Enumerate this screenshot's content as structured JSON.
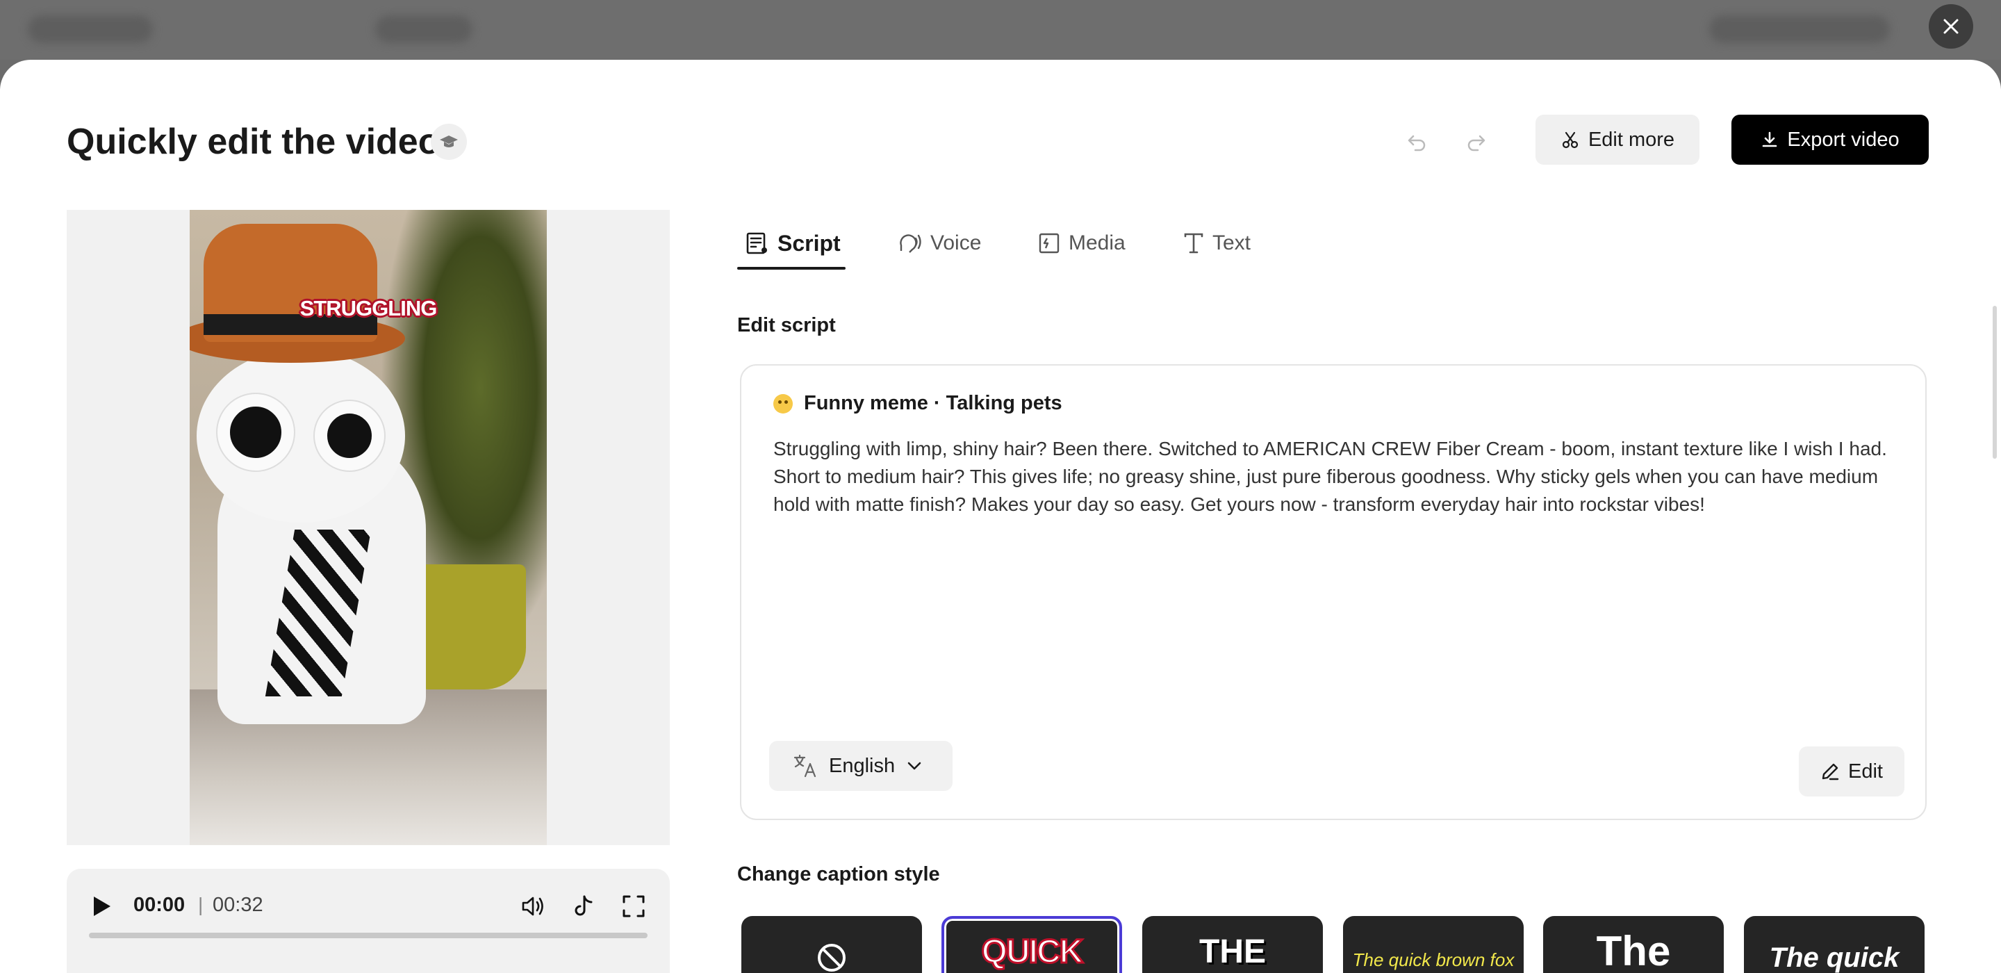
{
  "dialog": {
    "title": "Quickly edit the video",
    "edit_more_label": "Edit more",
    "export_label": "Export video"
  },
  "video": {
    "caption_word": "STRUGGLING",
    "current_time": "00:00",
    "separator": "|",
    "total_time": "00:32",
    "progress_percent": 0
  },
  "tabs": [
    {
      "label": "Script",
      "icon": "script-icon",
      "active": true
    },
    {
      "label": "Voice",
      "icon": "voice-icon",
      "active": false
    },
    {
      "label": "Media",
      "icon": "media-icon",
      "active": false
    },
    {
      "label": "Text",
      "icon": "text-icon",
      "active": false
    }
  ],
  "script": {
    "section_label": "Edit script",
    "tag": "Funny meme · Talking pets",
    "body": "Struggling with limp, shiny hair? Been there. Switched to AMERICAN CREW Fiber Cream - boom, instant texture like I wish I had. Short to medium hair? This gives life; no greasy shine, just pure fiberous goodness. Why sticky gels when you can have medium hold with matte finish? Makes your day so easy. Get yours now - transform everyday hair into rockstar vibes!",
    "language": "English",
    "edit_label": "Edit"
  },
  "caption_style": {
    "section_label": "Change caption style",
    "options": [
      {
        "label": "",
        "icon": "none-icon"
      },
      {
        "label": "QUICK"
      },
      {
        "label": "THE"
      },
      {
        "label": "The quick brown fox"
      },
      {
        "label": "The"
      },
      {
        "label": "The quick"
      }
    ],
    "selected_index": 1,
    "accent": "#4b3bd6"
  }
}
